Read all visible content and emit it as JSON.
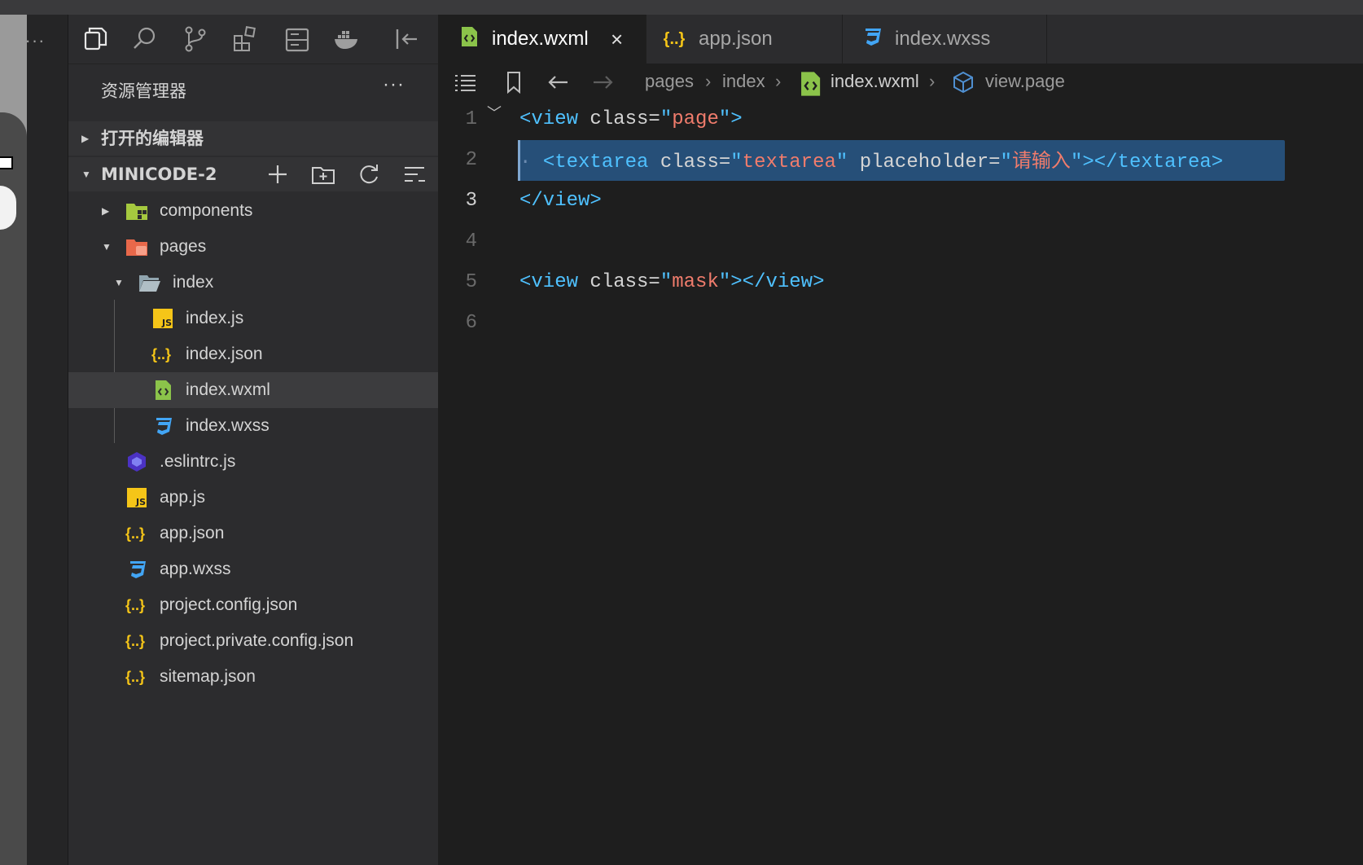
{
  "sidebar": {
    "title": "资源管理器",
    "more": "···",
    "open_editors": "打开的编辑器",
    "project": "MINICODE-2",
    "tree": [
      {
        "name": "components",
        "kind": "folder-green",
        "depth": 1,
        "expanded": false
      },
      {
        "name": "pages",
        "kind": "folder-orange",
        "depth": 1,
        "expanded": true
      },
      {
        "name": "index",
        "kind": "folder-blue",
        "depth": 2,
        "expanded": true
      },
      {
        "name": "index.js",
        "kind": "js",
        "depth": 3
      },
      {
        "name": "index.json",
        "kind": "json",
        "depth": 3
      },
      {
        "name": "index.wxml",
        "kind": "wxml",
        "depth": 3,
        "selected": true
      },
      {
        "name": "index.wxss",
        "kind": "wxss",
        "depth": 3
      },
      {
        "name": ".eslintrc.js",
        "kind": "eslint",
        "depth": 1
      },
      {
        "name": "app.js",
        "kind": "js",
        "depth": 1
      },
      {
        "name": "app.json",
        "kind": "json",
        "depth": 1
      },
      {
        "name": "app.wxss",
        "kind": "wxss",
        "depth": 1
      },
      {
        "name": "project.config.json",
        "kind": "json",
        "depth": 1
      },
      {
        "name": "project.private.config.json",
        "kind": "json",
        "depth": 1
      },
      {
        "name": "sitemap.json",
        "kind": "json",
        "depth": 1
      }
    ]
  },
  "band": {
    "more": "···"
  },
  "tabs": [
    {
      "label": "index.wxml",
      "kind": "wxml",
      "active": true,
      "close": "×"
    },
    {
      "label": "app.json",
      "kind": "json",
      "active": false
    },
    {
      "label": "index.wxss",
      "kind": "wxss",
      "active": false
    }
  ],
  "breadcrumb": {
    "items": [
      "pages",
      "index",
      "index.wxml",
      "view.page"
    ],
    "sep": "›"
  },
  "editor": {
    "line_numbers": [
      "1",
      "2",
      "3",
      "4",
      "5",
      "6"
    ],
    "current_line": 3,
    "lines": {
      "l1": {
        "open": "<view",
        "attr": " class=",
        "q1": "\"",
        "val": "page",
        "q2": "\"",
        "close": ">"
      },
      "l2": {
        "ws": "· ",
        "open": "<textarea",
        "sp1": " ",
        "attr1": "class=",
        "q1": "\"",
        "val1": "textarea",
        "q2": "\"",
        "sp2": " ",
        "attr2": "placeholder=",
        "q3": "\"",
        "val2": "请输入",
        "q4": "\"",
        "close": "></textarea>"
      },
      "l3": {
        "close": "</view>"
      },
      "l5": {
        "open": "<view",
        "attr": " class=",
        "q1": "\"",
        "val": "mask",
        "q2": "\"",
        "close": "></view>"
      }
    }
  },
  "colors": {
    "tag": "#4fc1ff",
    "string": "#f07c6c",
    "selection": "#264f78",
    "wxml_icon": "#8bc34a",
    "json_icon": "#f5c518",
    "wxss_icon": "#42a5f5",
    "js_icon": "#f5c518"
  }
}
